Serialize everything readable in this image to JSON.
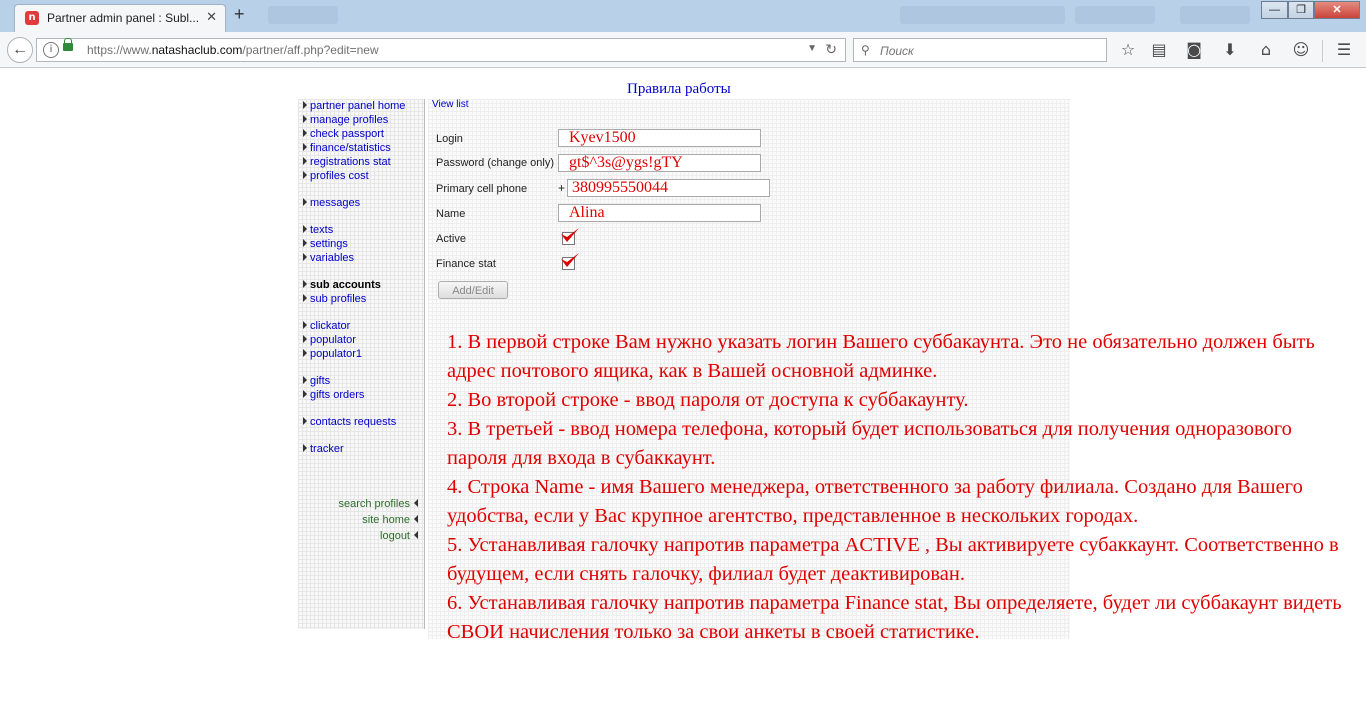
{
  "browser": {
    "tab_title": "Partner admin panel : Subl...",
    "favicon_text": "n",
    "url_prefix": "https://www.",
    "url_domain": "natashaclub.com",
    "url_path": "/partner/aff.php?edit=new",
    "search_placeholder": "Поиск",
    "colors": {
      "titlebar": "#b8d0e8",
      "close": "#c9443a"
    }
  },
  "page": {
    "rules_link": "Правила работы",
    "view_list": "View list"
  },
  "sidebar": {
    "items": [
      "partner panel home",
      "manage profiles",
      "check passport",
      "finance/statistics",
      "registrations stat",
      "profiles cost",
      "messages",
      "texts",
      "settings",
      "variables",
      "sub accounts",
      "sub profiles",
      "clickator",
      "populator",
      "populator1",
      "gifts",
      "gifts orders",
      "contacts requests",
      "tracker"
    ],
    "active": "sub accounts",
    "bottom_links": [
      "search profiles",
      "site home",
      "logout"
    ]
  },
  "form": {
    "login_label": "Login",
    "login_value": "Kyev1500",
    "password_label": "Password (change only)",
    "password_value": "gt$^3s@ygs!gTY",
    "phone_label": "Primary cell phone",
    "phone_prefix": "+",
    "phone_value": "380995550044",
    "name_label": "Name",
    "name_value": "Alina",
    "active_label": "Active",
    "active_checked": true,
    "finance_label": "Finance stat",
    "finance_checked": true,
    "submit_label": "Add/Edit"
  },
  "instructions": [
    "1. В первой строке Вам нужно указать логин Вашего суббакаунта. Это не обязательно должен быть адрес почтового ящика, как в Вашей основной админке.",
    "2. Во второй строке - ввод пароля от доступа к суббакаунту.",
    "3. В третьей - ввод номера телефона, который будет использоваться для получения одноразового пароля для входа в субаккаунт.",
    "4. Строка Name - имя Вашего менеджера, ответственного за работу филиала. Создано для Вашего удобства, если у Вас крупное агентство, представленное в нескольких городах.",
    "5. Устанавливая галочку напротив параметра ACTIVE , Вы активируете субаккаунт. Соответственно в будущем, если снять галочку, филиал будет деактивирован.",
    "6. Устанавливая галочку напротив параметра Finance stat, Вы определяете, будет ли суббакаунт видеть СВОИ начисления только за свои анкеты в своей статистике."
  ]
}
